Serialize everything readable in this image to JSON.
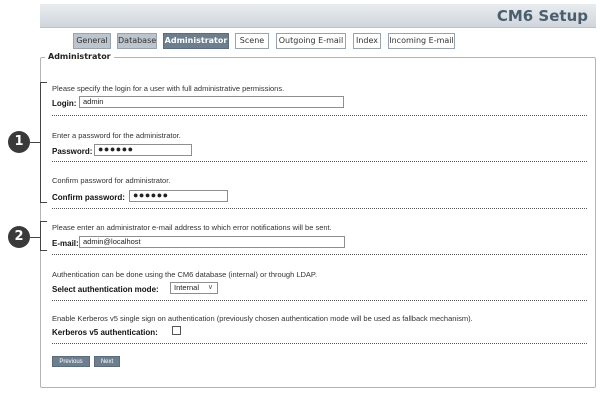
{
  "header": {
    "title": "CM6 Setup"
  },
  "tabs": [
    {
      "label": "General"
    },
    {
      "label": "Database"
    },
    {
      "label": "Administrator"
    },
    {
      "label": "Scene"
    },
    {
      "label": "Outgoing E-mail"
    },
    {
      "label": "Index"
    },
    {
      "label": "Incoming E-mail"
    }
  ],
  "section": {
    "legend": "Administrator"
  },
  "login": {
    "description": "Please specify the login for a user with full administrative permissions.",
    "label": "Login:",
    "value": "admin"
  },
  "password": {
    "description": "Enter a password for the administrator.",
    "label": "Password:",
    "value": "●●●●●●"
  },
  "confirm_password": {
    "description": "Confirm password for administrator.",
    "label": "Confirm password:",
    "value": "●●●●●●"
  },
  "email": {
    "description": "Please enter an administrator e-mail address to which error notifications will be sent.",
    "label": "E-mail:",
    "value": "admin@localhost"
  },
  "auth": {
    "description": "Authentication can be done using the CM6 database (internal) or through LDAP.",
    "label": "Select authentication mode:",
    "selected": "Internal"
  },
  "kerberos": {
    "description": "Enable Kerberos v5 single sign on authentication (previously chosen authentication mode will be used as fallback mechanism).",
    "label": "Kerberos v5 authentication:",
    "checked": false
  },
  "buttons": {
    "previous": "Previous",
    "next": "Next"
  },
  "callouts": {
    "one": "1",
    "two": "2"
  }
}
